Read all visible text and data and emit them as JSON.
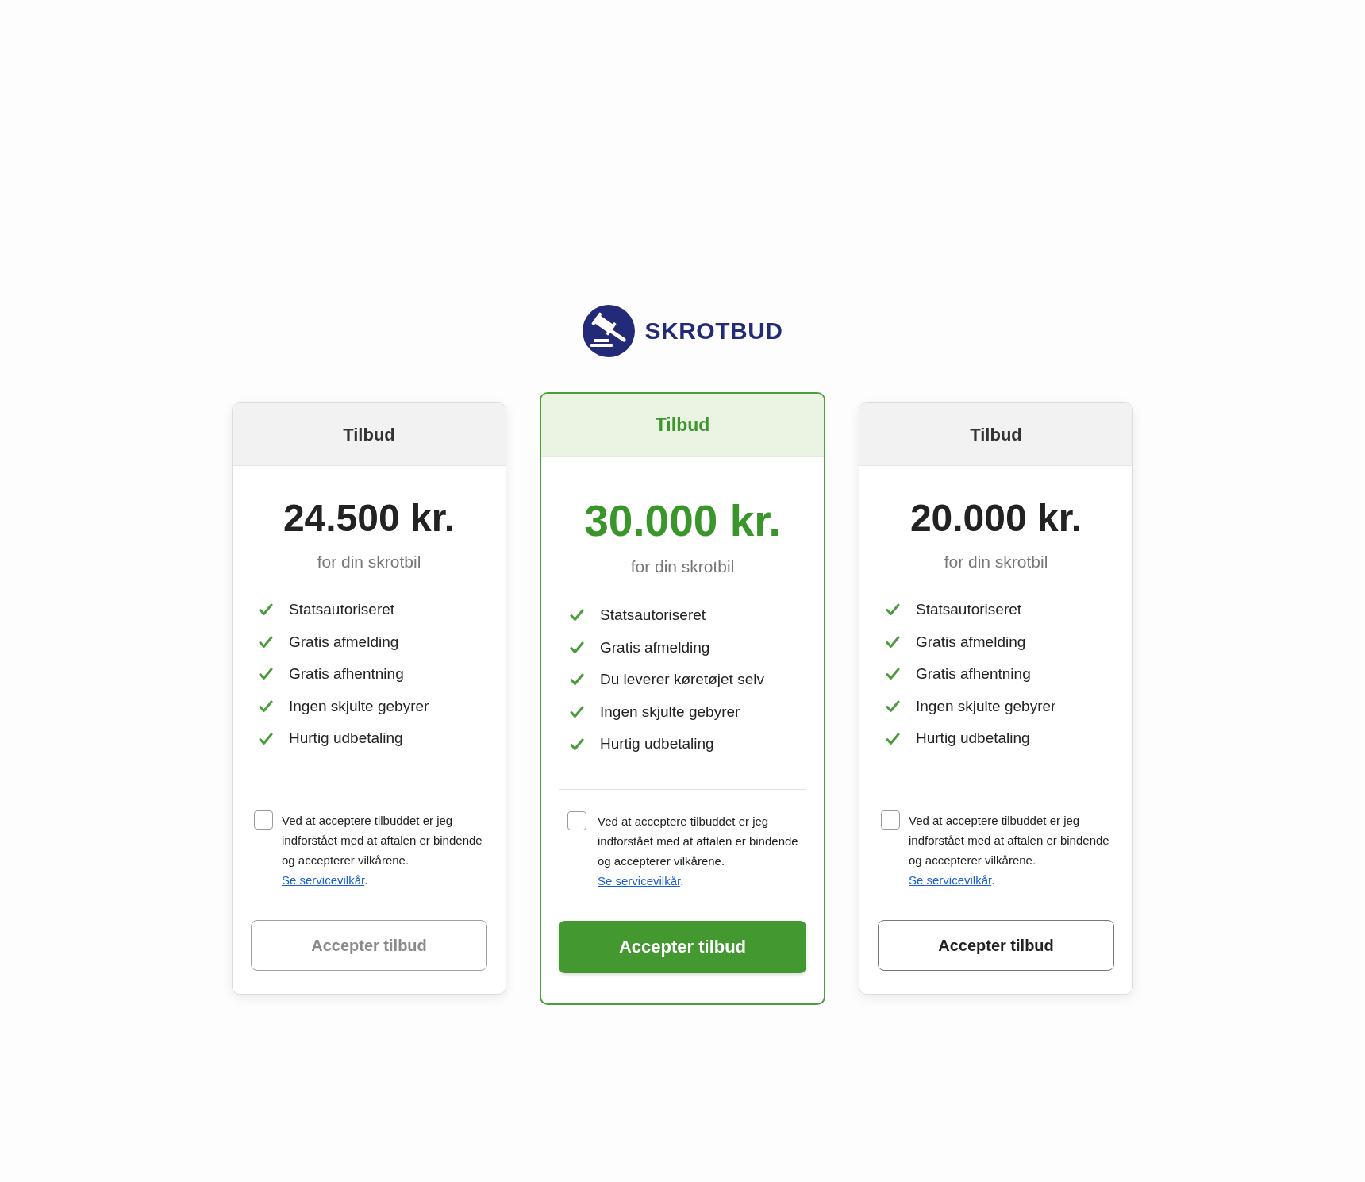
{
  "logo": {
    "text": "SKROTBUD"
  },
  "offers": [
    {
      "featured": false,
      "header": "Tilbud",
      "price": "24.500 kr.",
      "subtitle": "for din skrotbil",
      "features": [
        "Statsautoriseret",
        "Gratis afmelding",
        "Gratis afhentning",
        "Ingen skjulte gebyrer",
        "Hurtig udbetaling"
      ],
      "terms": {
        "checked": false,
        "text": "Ved at acceptere tilbuddet er jeg indforstået med at aftalen er bindende og accepterer vilkårene.",
        "link": "Se servicevilkår",
        "after_link": "."
      },
      "button": {
        "label": "Accepter tilbud",
        "disabled": true
      }
    },
    {
      "featured": true,
      "header": "Tilbud",
      "price": "30.000 kr.",
      "subtitle": "for din skrotbil",
      "features": [
        "Statsautoriseret",
        "Gratis afmelding",
        "Du leverer køretøjet selv",
        "Ingen skjulte gebyrer",
        "Hurtig udbetaling"
      ],
      "terms": {
        "checked": false,
        "text": "Ved at acceptere tilbuddet er jeg indforstået med at aftalen er bindende og accepterer vilkårene.",
        "link": "Se servicevilkår",
        "after_link": "."
      },
      "button": {
        "label": "Accepter tilbud",
        "disabled": false
      }
    },
    {
      "featured": false,
      "header": "Tilbud",
      "price": "20.000 kr.",
      "subtitle": "for din skrotbil",
      "features": [
        "Statsautoriseret",
        "Gratis afmelding",
        "Gratis afhentning",
        "Ingen skjulte gebyrer",
        "Hurtig udbetaling"
      ],
      "terms": {
        "checked": false,
        "text": "Ved at acceptere tilbuddet er jeg indforstået med at aftalen er bindende og accepterer vilkårene.",
        "link": "Se servicevilkår",
        "after_link": "."
      },
      "button": {
        "label": "Accepter tilbud",
        "disabled": false
      }
    }
  ]
}
